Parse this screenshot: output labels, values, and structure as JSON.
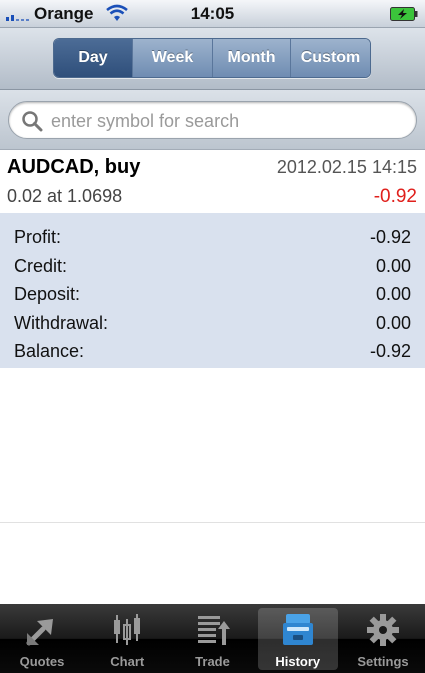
{
  "status_bar": {
    "carrier": "Orange",
    "time": "14:05"
  },
  "period_tabs": {
    "items": [
      {
        "label": "Day",
        "active": true
      },
      {
        "label": "Week",
        "active": false
      },
      {
        "label": "Month",
        "active": false
      },
      {
        "label": "Custom",
        "active": false
      }
    ]
  },
  "search": {
    "placeholder": "enter symbol for search",
    "value": ""
  },
  "trade": {
    "symbol": "AUDCAD, buy",
    "datetime": "2012.02.15 14:15",
    "volume_price": "0.02 at 1.0698",
    "profit": "-0.92",
    "profit_color": "#e0201c"
  },
  "summary": {
    "rows": [
      {
        "label": "Profit:",
        "value": "-0.92"
      },
      {
        "label": "Credit:",
        "value": "0.00"
      },
      {
        "label": "Deposit:",
        "value": "0.00"
      },
      {
        "label": "Withdrawal:",
        "value": "0.00"
      },
      {
        "label": "Balance:",
        "value": "-0.92"
      }
    ],
    "background": "#d9e1ee"
  },
  "tab_bar": {
    "items": [
      {
        "label": "Quotes",
        "icon": "quotes-arrows-icon",
        "active": false
      },
      {
        "label": "Chart",
        "icon": "candlestick-chart-icon",
        "active": false
      },
      {
        "label": "Trade",
        "icon": "trade-list-icon",
        "active": false
      },
      {
        "label": "History",
        "icon": "history-archive-icon",
        "active": true
      },
      {
        "label": "Settings",
        "icon": "gear-icon",
        "active": false
      }
    ]
  },
  "colors": {
    "segment_active": "#2f4f7b",
    "segment_inactive": "#6f8cb2",
    "tab_active_icon": "#4aa3e8"
  }
}
